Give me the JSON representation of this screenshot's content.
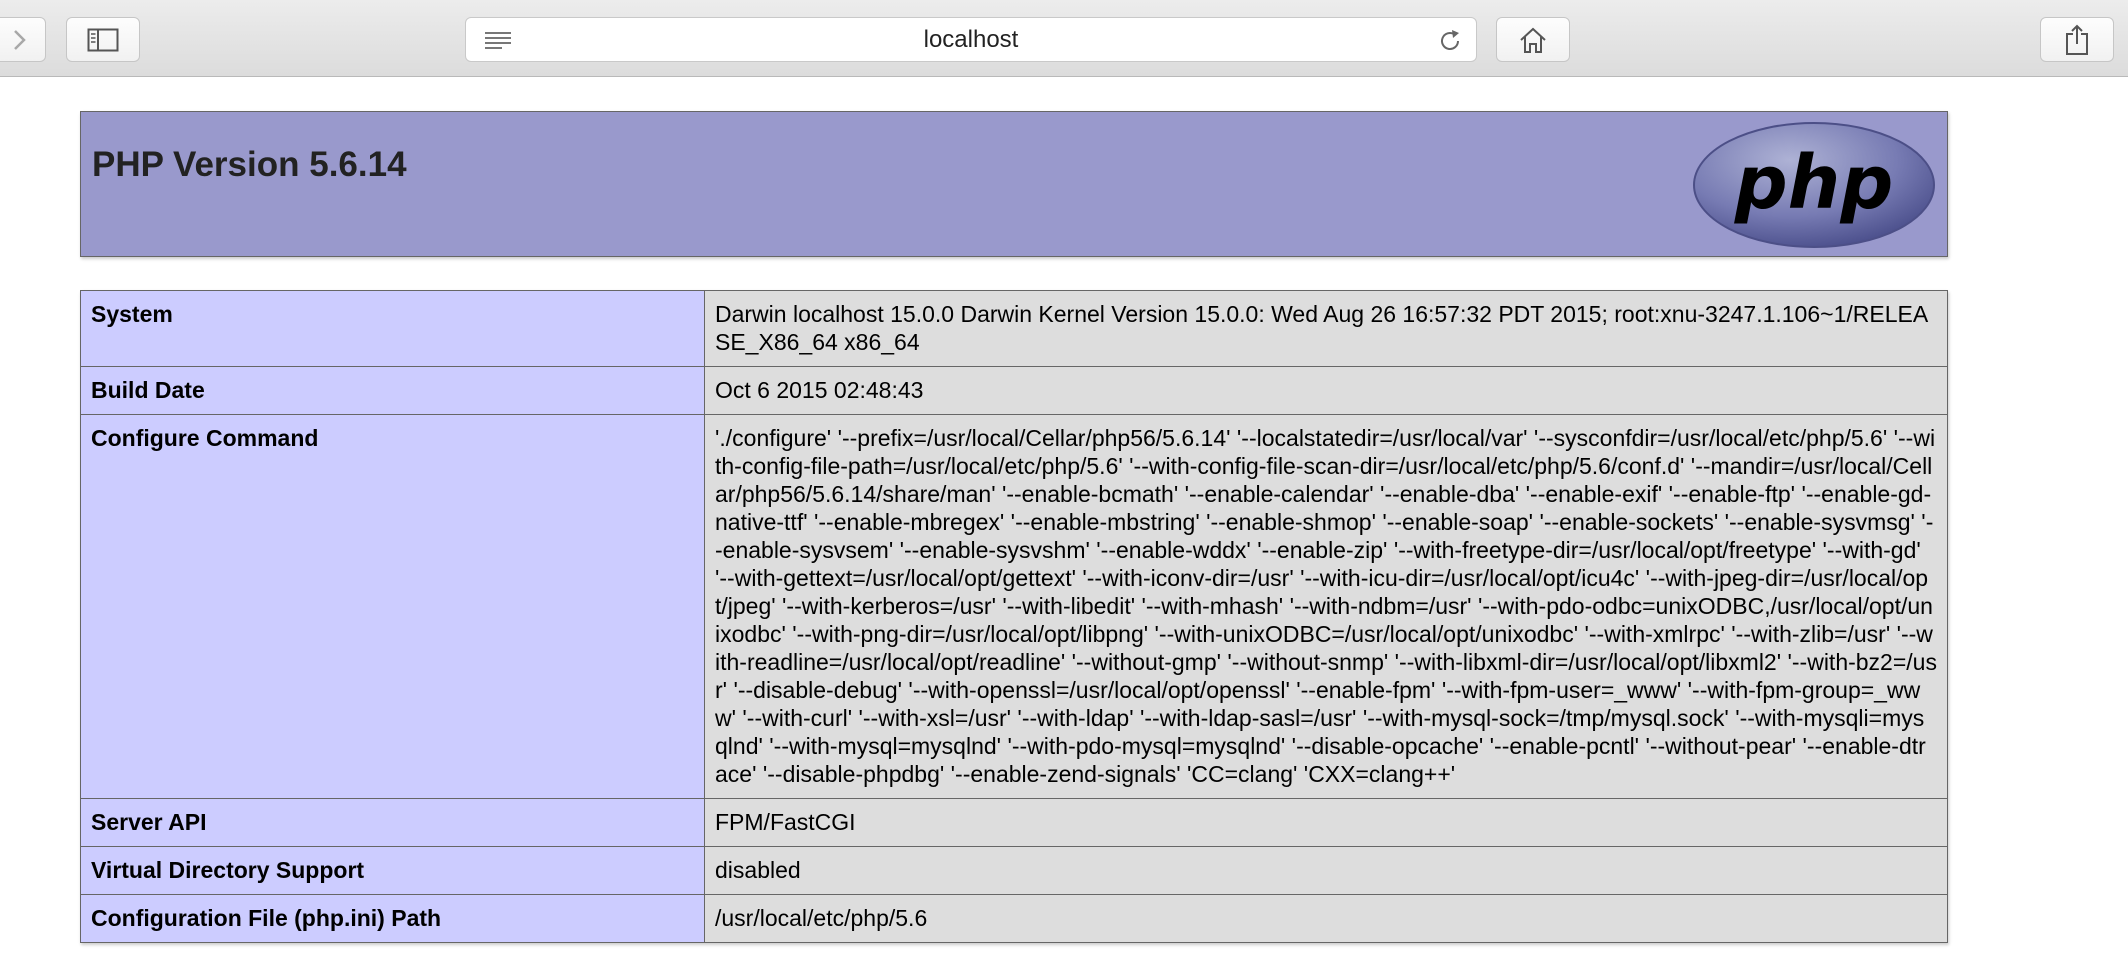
{
  "browser": {
    "url": "localhost"
  },
  "header": {
    "title": "PHP Version 5.6.14",
    "logo_text": "php"
  },
  "rows": [
    {
      "key": "System",
      "value": "Darwin localhost 15.0.0 Darwin Kernel Version 15.0.0: Wed Aug 26 16:57:32 PDT 2015; root:xnu-3247.1.106~1/RELEASE_X86_64 x86_64"
    },
    {
      "key": "Build Date",
      "value": "Oct 6 2015 02:48:43"
    },
    {
      "key": "Configure Command",
      "value": "'./configure' '--prefix=/usr/local/Cellar/php56/5.6.14' '--localstatedir=/usr/local/var' '--sysconfdir=/usr/local/etc/php/5.6' '--with-config-file-path=/usr/local/etc/php/5.6' '--with-config-file-scan-dir=/usr/local/etc/php/5.6/conf.d' '--mandir=/usr/local/Cellar/php56/5.6.14/share/man' '--enable-bcmath' '--enable-calendar' '--enable-dba' '--enable-exif' '--enable-ftp' '--enable-gd-native-ttf' '--enable-mbregex' '--enable-mbstring' '--enable-shmop' '--enable-soap' '--enable-sockets' '--enable-sysvmsg' '--enable-sysvsem' '--enable-sysvshm' '--enable-wddx' '--enable-zip' '--with-freetype-dir=/usr/local/opt/freetype' '--with-gd' '--with-gettext=/usr/local/opt/gettext' '--with-iconv-dir=/usr' '--with-icu-dir=/usr/local/opt/icu4c' '--with-jpeg-dir=/usr/local/opt/jpeg' '--with-kerberos=/usr' '--with-libedit' '--with-mhash' '--with-ndbm=/usr' '--with-pdo-odbc=unixODBC,/usr/local/opt/unixodbc' '--with-png-dir=/usr/local/opt/libpng' '--with-unixODBC=/usr/local/opt/unixodbc' '--with-xmlrpc' '--with-zlib=/usr' '--with-readline=/usr/local/opt/readline' '--without-gmp' '--without-snmp' '--with-libxml-dir=/usr/local/opt/libxml2' '--with-bz2=/usr' '--disable-debug' '--with-openssl=/usr/local/opt/openssl' '--enable-fpm' '--with-fpm-user=_www' '--with-fpm-group=_www' '--with-curl' '--with-xsl=/usr' '--with-ldap' '--with-ldap-sasl=/usr' '--with-mysql-sock=/tmp/mysql.sock' '--with-mysqli=mysqlnd' '--with-mysql=mysqlnd' '--with-pdo-mysql=mysqlnd' '--disable-opcache' '--enable-pcntl' '--without-pear' '--enable-dtrace' '--disable-phpdbg' '--enable-zend-signals' 'CC=clang' 'CXX=clang++'"
    },
    {
      "key": "Server API",
      "value": "FPM/FastCGI"
    },
    {
      "key": "Virtual Directory Support",
      "value": "disabled"
    },
    {
      "key": "Configuration File (php.ini) Path",
      "value": "/usr/local/etc/php/5.6"
    }
  ],
  "colors": {
    "header_bg": "#9999cc",
    "key_bg": "#ccccff",
    "value_bg": "#dddddd"
  },
  "icons": {
    "forward": "chevron-right-icon",
    "sidebar": "sidebar-icon",
    "reader": "reader-icon",
    "reload": "reload-icon",
    "home": "home-icon",
    "share": "share-icon"
  }
}
